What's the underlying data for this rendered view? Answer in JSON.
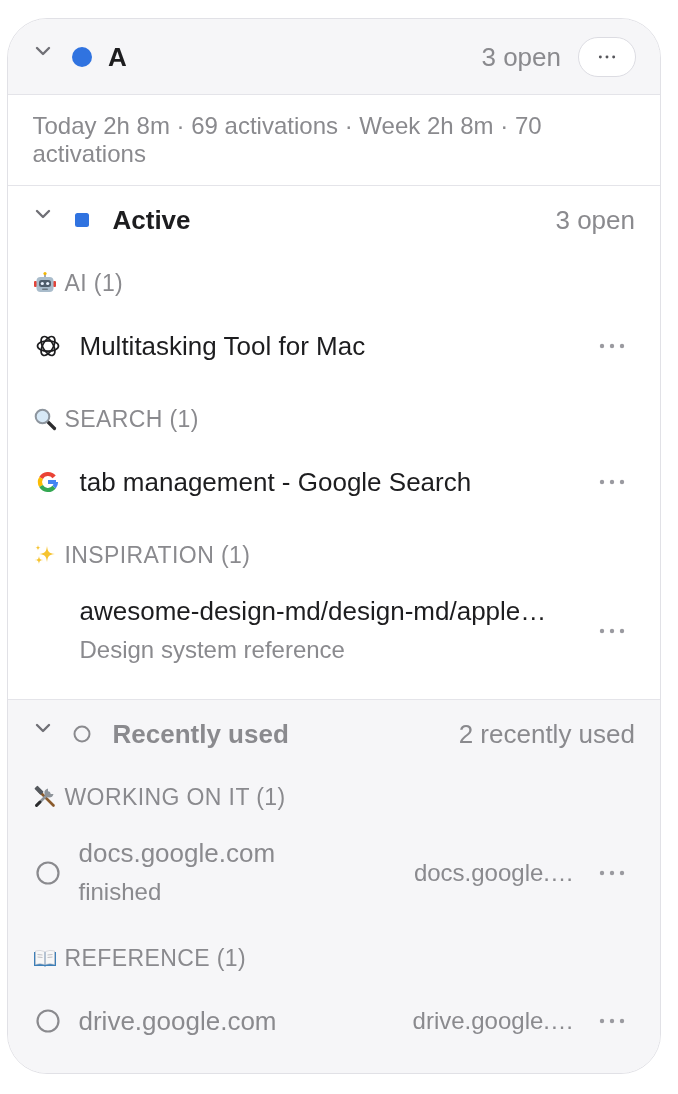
{
  "workspace": {
    "name": "A",
    "color": "#3073e0",
    "expanded": true,
    "count": "3 open"
  },
  "stats": "Today 2h 8m · 69 activations · Week 2h 8m · 70 activations",
  "sections": [
    {
      "title": "Active",
      "kind": "open",
      "expanded": true,
      "count": "3 open",
      "groups": [
        {
          "label": "AI (1)",
          "items": [
            {
              "title": "Multitasking Tool for Mac"
            }
          ]
        },
        {
          "label": "SEARCH (1)",
          "items": [
            {
              "title": "tab management - Google Search"
            }
          ]
        },
        {
          "label": "INSPIRATION (1)",
          "items": [
            {
              "title": "awesome-design-md/design-md/apple…",
              "subtitle": "Design system reference"
            }
          ]
        }
      ]
    },
    {
      "title": "Recently used",
      "kind": "recent",
      "expanded": true,
      "count": "2 recently used",
      "groups": [
        {
          "label": "WORKING ON IT (1)",
          "items": [
            {
              "title": "docs.google.com",
              "subtitle": "finished",
              "domain": "docs.google.…"
            }
          ]
        },
        {
          "label": "REFERENCE (1)",
          "items": [
            {
              "title": "drive.google.com",
              "domain": "drive.google.…"
            }
          ]
        }
      ]
    }
  ]
}
